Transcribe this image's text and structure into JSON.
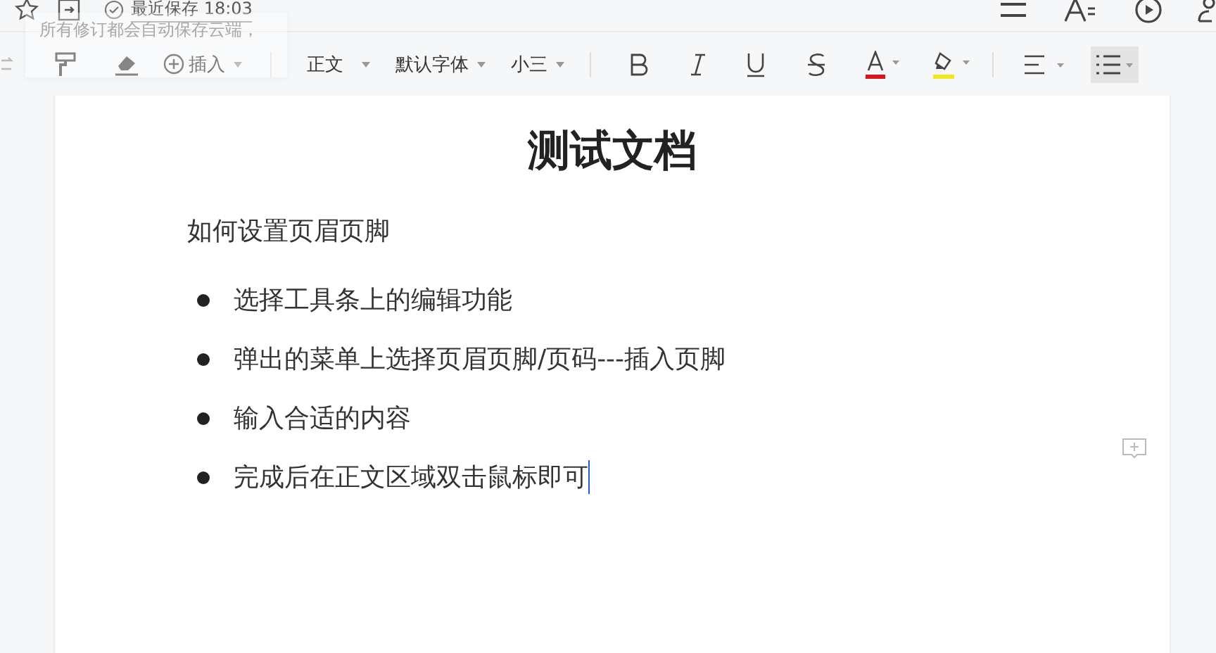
{
  "top_bar": {
    "save_status": "最近保存 18:03"
  },
  "tooltip": {
    "lines": [
      "所有修订都会自动保存云端，"
    ]
  },
  "toolbar": {
    "insert": "插入",
    "paragraph_style": "正文",
    "font": "默认字体",
    "font_size": "小三",
    "bullet_list_selected": true
  },
  "document": {
    "title": "测试文档",
    "paragraph": "如何设置页眉页脚",
    "bullets": [
      "选择工具条上的编辑功能",
      "弹出的菜单上选择页眉页脚/页码---插入页脚",
      "输入合适的内容",
      "完成后在正文区域双击鼠标即可"
    ],
    "cursor_in_last_bullet": true
  }
}
